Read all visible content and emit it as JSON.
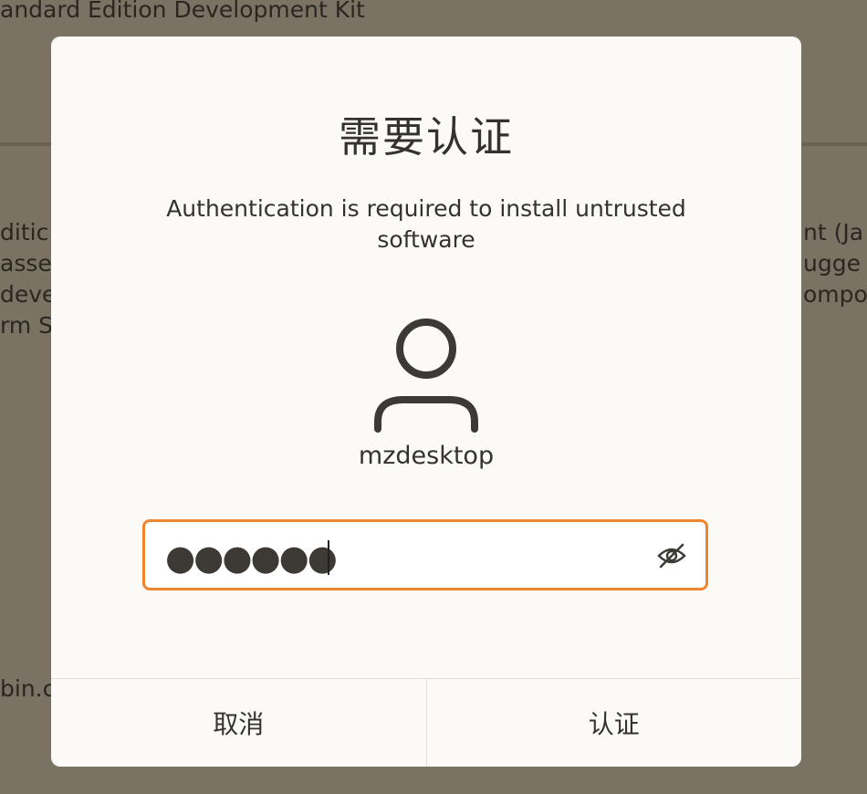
{
  "background_window": {
    "title_fragment": "andard Edition Development Kit",
    "left_fragments": [
      "ditic",
      "asse",
      "deve",
      "rm S"
    ],
    "right_fragments": [
      "nt (Ja",
      "ugge",
      "ompo"
    ],
    "bin_fragment": "bin.c"
  },
  "dialog": {
    "title": "需要认证",
    "message": "Authentication is required to install untrusted software",
    "avatar_icon": "user-icon",
    "username": "mzdesktop",
    "password": {
      "masked_value": "●●●●●●",
      "visibility_icon": "eye-hidden-icon",
      "focus_color": "#f0852f"
    },
    "buttons": {
      "cancel_label": "取消",
      "authenticate_label": "认证"
    }
  }
}
